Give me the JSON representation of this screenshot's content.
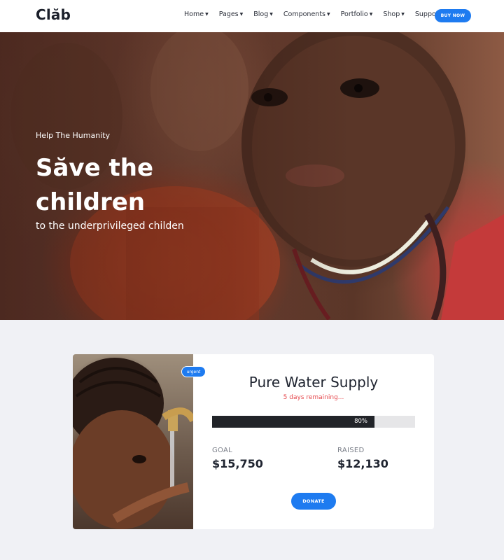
{
  "header": {
    "logo": "Clăb",
    "nav": [
      {
        "label": "Home"
      },
      {
        "label": "Pages"
      },
      {
        "label": "Blog"
      },
      {
        "label": "Components"
      },
      {
        "label": "Portfolio"
      },
      {
        "label": "Shop"
      },
      {
        "label": "Support"
      }
    ],
    "buy_now": "BUY NOW",
    "caret_icon": "chevron-down-icon"
  },
  "hero": {
    "eyebrow": "Help The Humanity",
    "title": "Săve the children",
    "subtitle": "to the underprivileged childen"
  },
  "campaign": {
    "badge": "urgent",
    "title": "Pure Water Supply",
    "remaining": "5 days remaining...",
    "progress_percent": 80,
    "progress_label": "80%",
    "goal_label": "GOAL",
    "goal_value": "$15,750",
    "raised_label": "RAISED",
    "raised_value": "$12,130",
    "donate": "DONATE"
  },
  "colors": {
    "accent": "#1e7bf0",
    "remaining": "#e5484d",
    "progress": "#222429",
    "background": "#f0f1f5"
  }
}
